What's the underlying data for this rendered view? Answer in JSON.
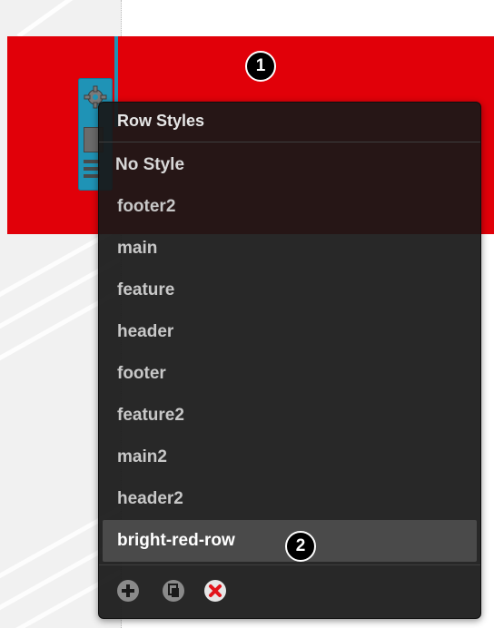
{
  "popup": {
    "title": "Row Styles",
    "items": [
      {
        "label": "No Style"
      },
      {
        "label": "footer2"
      },
      {
        "label": "main"
      },
      {
        "label": "feature"
      },
      {
        "label": "header"
      },
      {
        "label": "footer"
      },
      {
        "label": "feature2"
      },
      {
        "label": "main2"
      },
      {
        "label": "header2"
      },
      {
        "label": "bright-red-row"
      }
    ],
    "selected_item": "bright-red-row",
    "footer_icons": [
      "add-icon",
      "duplicate-icon",
      "delete-icon"
    ]
  },
  "callouts": {
    "one": "1",
    "two": "2"
  },
  "icons": {
    "row_handle_gear": "gear-icon",
    "row_handle_menu": "hamburger-icon"
  },
  "colors": {
    "row_red": "#e10009",
    "handle_blue": "#1f93b6",
    "popup_bg": "#181818",
    "selected_bg": "#4a4a4a",
    "delete_red": "#e2141b"
  }
}
